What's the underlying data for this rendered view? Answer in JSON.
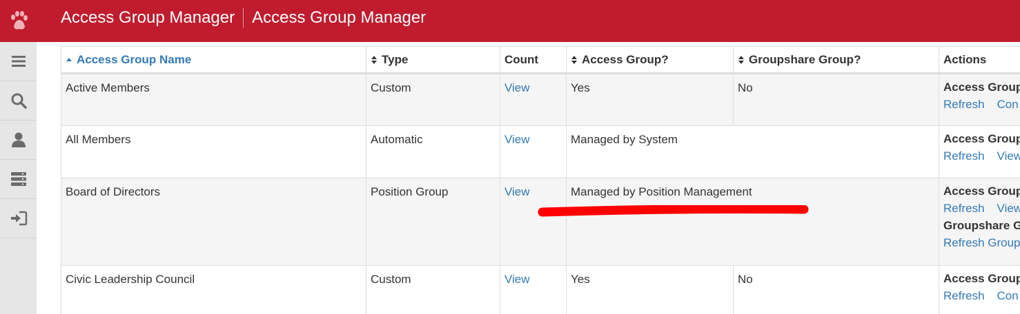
{
  "header": {
    "title_left": "Access Group Manager",
    "title_right": "Access Group Manager",
    "logo_icon": "paw-icon",
    "bg_color": "#c01c2e"
  },
  "sidenav": {
    "items": [
      {
        "icon": "menu-icon"
      },
      {
        "icon": "search-icon"
      },
      {
        "icon": "user-icon"
      },
      {
        "icon": "server-icon"
      },
      {
        "icon": "sign-in-icon"
      }
    ]
  },
  "table": {
    "columns": [
      {
        "label": "Access Group Name",
        "sortable": true,
        "sorted": "asc"
      },
      {
        "label": "Type",
        "sortable": true
      },
      {
        "label": "Count",
        "sortable": false
      },
      {
        "label": "Access Group?",
        "sortable": true
      },
      {
        "label": "Groupshare Group?",
        "sortable": true
      },
      {
        "label": "Actions",
        "sortable": false
      }
    ],
    "rows": [
      {
        "name": "Active Members",
        "type": "Custom",
        "count": "View",
        "access_group": "Yes",
        "groupshare": "No",
        "actions": {
          "title": "Access Group",
          "link1": "Refresh",
          "link2": "Con"
        }
      },
      {
        "name": "All Members",
        "type": "Automatic",
        "count": "View",
        "managed": "Managed by System",
        "actions": {
          "title": "Access Group",
          "link1": "Refresh",
          "link2": "View"
        }
      },
      {
        "name": "Board of Directors",
        "type": "Position Group",
        "count": "View",
        "managed": "Managed by Position Management",
        "actions": {
          "title": "Access Group",
          "link1": "Refresh",
          "link2": "View",
          "title2": "Groupshare G",
          "link3": "Refresh Group"
        }
      },
      {
        "name": "Civic Leadership Council",
        "type": "Custom",
        "count": "View",
        "access_group": "Yes",
        "groupshare": "No",
        "actions": {
          "title": "Access Group",
          "link1": "Refresh",
          "link2": "Con"
        }
      }
    ]
  },
  "annotation": {
    "color": "#ff0000"
  }
}
